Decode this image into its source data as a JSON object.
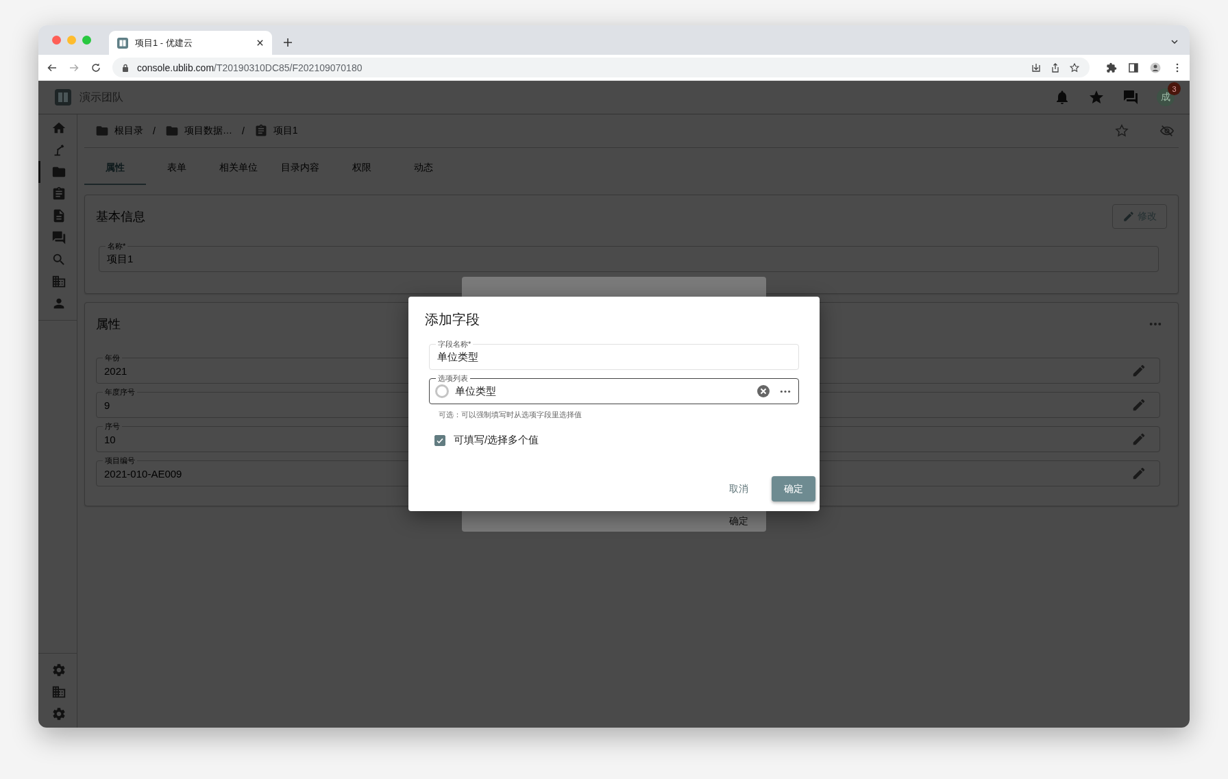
{
  "browser": {
    "tab_title": "项目1 - 优建云",
    "url_host": "console.ublib.com",
    "url_path": "/T20190310DC85/F202109070180"
  },
  "app": {
    "team": "演示团队",
    "notification_badge": "3",
    "avatar": "成"
  },
  "sidebar": {
    "items": [
      {
        "kind": "home",
        "selected": false
      },
      {
        "kind": "lamp",
        "selected": false
      },
      {
        "kind": "folder",
        "selected": true
      },
      {
        "kind": "clipboard",
        "selected": false
      },
      {
        "kind": "document",
        "selected": false
      },
      {
        "kind": "chat",
        "selected": false
      },
      {
        "kind": "search",
        "selected": false
      },
      {
        "kind": "building",
        "selected": false
      },
      {
        "kind": "person",
        "selected": false
      }
    ],
    "bottom_items": [
      {
        "kind": "gear"
      },
      {
        "kind": "building"
      },
      {
        "kind": "gear"
      }
    ]
  },
  "breadcrumb": [
    {
      "kind": "folder",
      "label": "根目录",
      "separator": "/"
    },
    {
      "kind": "folder",
      "label": "项目数据…",
      "separator": "/"
    },
    {
      "kind": "clipboard",
      "label": "项目1"
    }
  ],
  "tabs": [
    {
      "label": "属性",
      "selected": true
    },
    {
      "label": "表单",
      "selected": false
    },
    {
      "label": "相关单位",
      "selected": false
    },
    {
      "label": "目录内容",
      "selected": false
    },
    {
      "label": "权限",
      "selected": false
    },
    {
      "label": "动态",
      "selected": false
    }
  ],
  "basic_info": {
    "title": "基本信息",
    "edit_button": "修改",
    "name_field": {
      "label": "名称*",
      "value": "项目1"
    }
  },
  "properties": {
    "title": "属性",
    "fields": [
      {
        "label": "年份",
        "value": "2021"
      },
      {
        "label": "年度序号",
        "value": "9"
      },
      {
        "label": "序号",
        "value": "10"
      },
      {
        "label": "项目编号",
        "value": "2021-010-AE009"
      }
    ]
  },
  "back_dialog": {
    "confirm": "确定"
  },
  "dialog": {
    "title": "添加字段",
    "name_field": {
      "label": "字段名称*",
      "value": "单位类型"
    },
    "options_field": {
      "label": "选项列表",
      "value": "单位类型",
      "hint": "可选：可以强制填写时从选项字段里选择值"
    },
    "multi": {
      "label": "可填写/选择多个值",
      "checked": true
    },
    "cancel": "取消",
    "confirm": "确定"
  }
}
